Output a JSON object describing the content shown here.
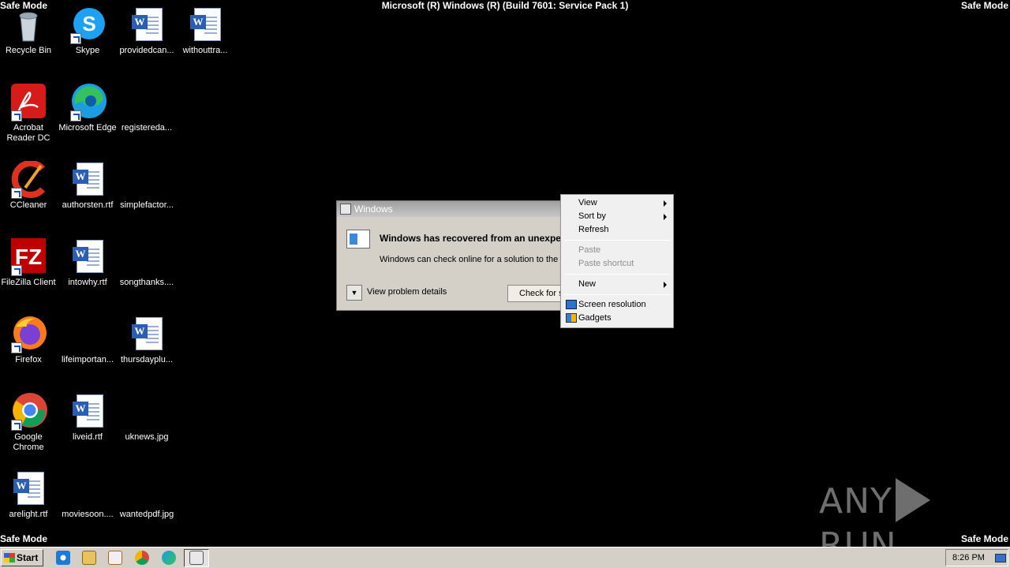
{
  "system": {
    "safe_mode_label": "Safe Mode",
    "build_title": "Microsoft (R) Windows (R) (Build 7601: Service Pack 1)"
  },
  "desktop_icons": [
    {
      "label": "Recycle Bin",
      "icon": "recycle-bin-icon"
    },
    {
      "label": "Skype",
      "icon": "skype-icon"
    },
    {
      "label": "providedcan...",
      "icon": "word-document-icon"
    },
    {
      "label": "withouttra...",
      "icon": "word-document-icon"
    },
    {
      "label": "Acrobat Reader DC",
      "icon": "acrobat-icon"
    },
    {
      "label": "Microsoft Edge",
      "icon": "edge-icon"
    },
    {
      "label": "registereda...",
      "icon": "blank-file-icon"
    },
    {
      "label": "CCleaner",
      "icon": "ccleaner-icon"
    },
    {
      "label": "authorsten.rtf",
      "icon": "word-document-icon"
    },
    {
      "label": "simplefactor...",
      "icon": "blank-file-icon"
    },
    {
      "label": "FileZilla Client",
      "icon": "filezilla-icon"
    },
    {
      "label": "intowhy.rtf",
      "icon": "word-document-icon"
    },
    {
      "label": "songthanks....",
      "icon": "blank-file-icon"
    },
    {
      "label": "Firefox",
      "icon": "firefox-icon"
    },
    {
      "label": "lifeimportan...",
      "icon": "blank-file-icon"
    },
    {
      "label": "thursdayplu...",
      "icon": "word-document-icon"
    },
    {
      "label": "Google Chrome",
      "icon": "chrome-icon"
    },
    {
      "label": "liveid.rtf",
      "icon": "word-document-icon"
    },
    {
      "label": "uknews.jpg",
      "icon": "blank-file-icon"
    },
    {
      "label": "arelight.rtf",
      "icon": "word-document-icon"
    },
    {
      "label": "moviesoon....",
      "icon": "blank-file-icon"
    },
    {
      "label": "wantedpdf.jpg",
      "icon": "blank-file-icon"
    }
  ],
  "dialog": {
    "title": "Windows",
    "heading": "Windows has recovered from an unexpected shutdown",
    "subtext": "Windows can check online for a solution to the problem.",
    "details_label": "View problem details",
    "check_button": "Check for solution"
  },
  "context_menu": {
    "view": "View",
    "sort_by": "Sort by",
    "refresh": "Refresh",
    "paste": "Paste",
    "paste_shortcut": "Paste shortcut",
    "new": "New",
    "screen_resolution": "Screen resolution",
    "gadgets": "Gadgets"
  },
  "taskbar": {
    "start_label": "Start",
    "clock": "8:26 PM"
  },
  "watermark": {
    "left": "ANY",
    "right": "RUN"
  }
}
